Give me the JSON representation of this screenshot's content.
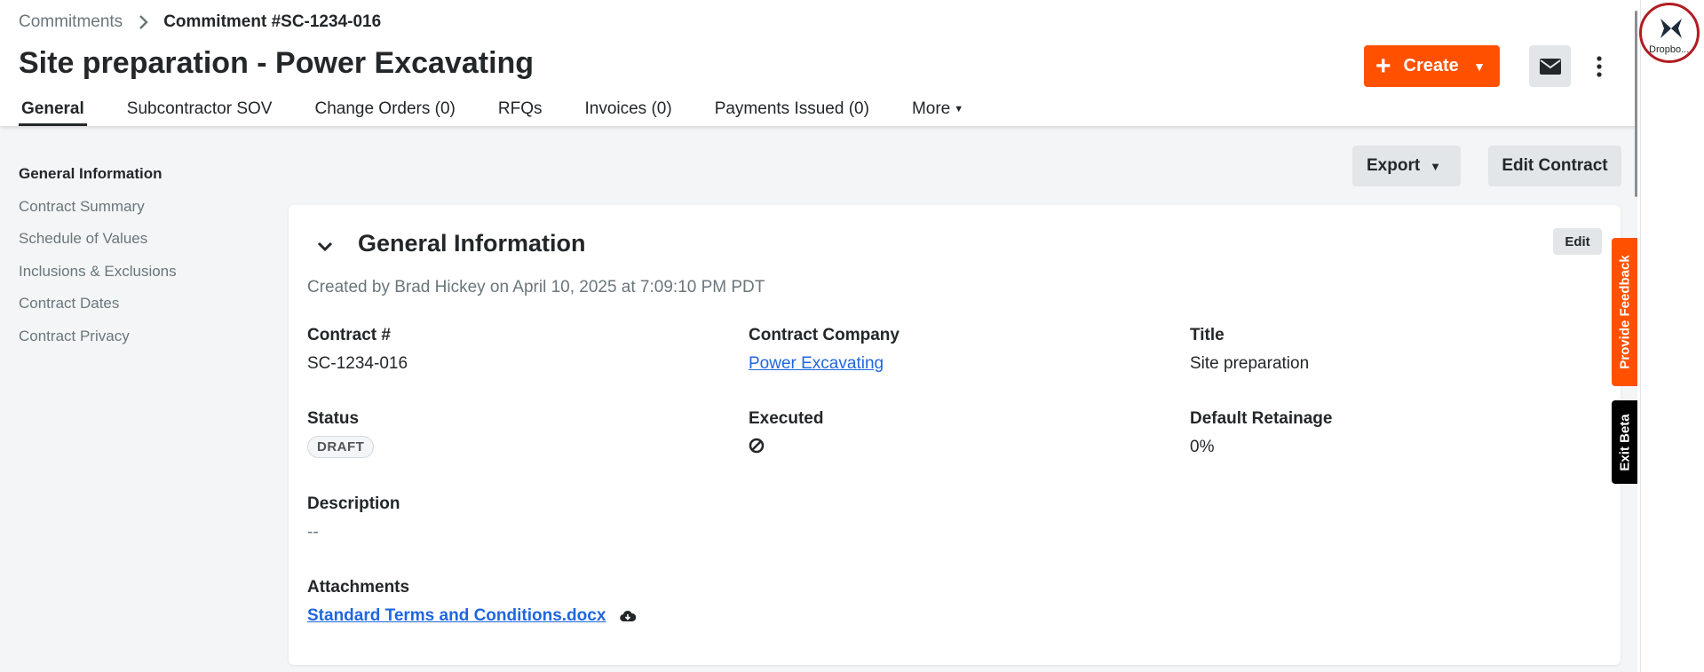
{
  "breadcrumb": {
    "parent": "Commitments",
    "current": "Commitment #SC-1234-016"
  },
  "page_title": "Site preparation - Power Excavating",
  "header_actions": {
    "create_label": "Create",
    "mail_icon": "envelope-icon",
    "more_icon": "kebab-icon"
  },
  "tabs": [
    {
      "label": "General",
      "active": true
    },
    {
      "label": "Subcontractor SOV"
    },
    {
      "label": "Change Orders (0)"
    },
    {
      "label": "RFQs"
    },
    {
      "label": "Invoices (0)"
    },
    {
      "label": "Payments Issued (0)"
    },
    {
      "label": "More"
    }
  ],
  "sidebar": {
    "items": [
      {
        "label": "General Information",
        "active": true
      },
      {
        "label": "Contract Summary"
      },
      {
        "label": "Schedule of Values"
      },
      {
        "label": "Inclusions & Exclusions"
      },
      {
        "label": "Contract Dates"
      },
      {
        "label": "Contract Privacy"
      }
    ]
  },
  "toolbar": {
    "export_label": "Export",
    "edit_contract_label": "Edit Contract"
  },
  "general_info": {
    "title": "General Information",
    "edit_label": "Edit",
    "created_text": "Created by Brad Hickey on April 10, 2025 at 7:09:10 PM PDT",
    "contract_number_label": "Contract #",
    "contract_number": "SC-1234-016",
    "company_label": "Contract Company",
    "company": "Power Excavating",
    "title_label": "Title",
    "title_value": "Site preparation",
    "status_label": "Status",
    "status": "DRAFT",
    "executed_label": "Executed",
    "executed_icon": "not-executed-icon",
    "retainage_label": "Default Retainage",
    "retainage": "0%",
    "description_label": "Description",
    "description": "--",
    "attachments_label": "Attachments",
    "attachment_name": "Standard Terms and Conditions.docx",
    "attachment_icon": "cloud-download-icon"
  },
  "side_tabs": {
    "feedback": "Provide Feedback",
    "exit_beta": "Exit Beta"
  },
  "dropbox": {
    "label": "Dropbo..."
  },
  "colors": {
    "brand_orange": "#ff5100",
    "link_blue": "#2066df",
    "text_dark": "#232729",
    "text_muted": "#6a767c"
  }
}
